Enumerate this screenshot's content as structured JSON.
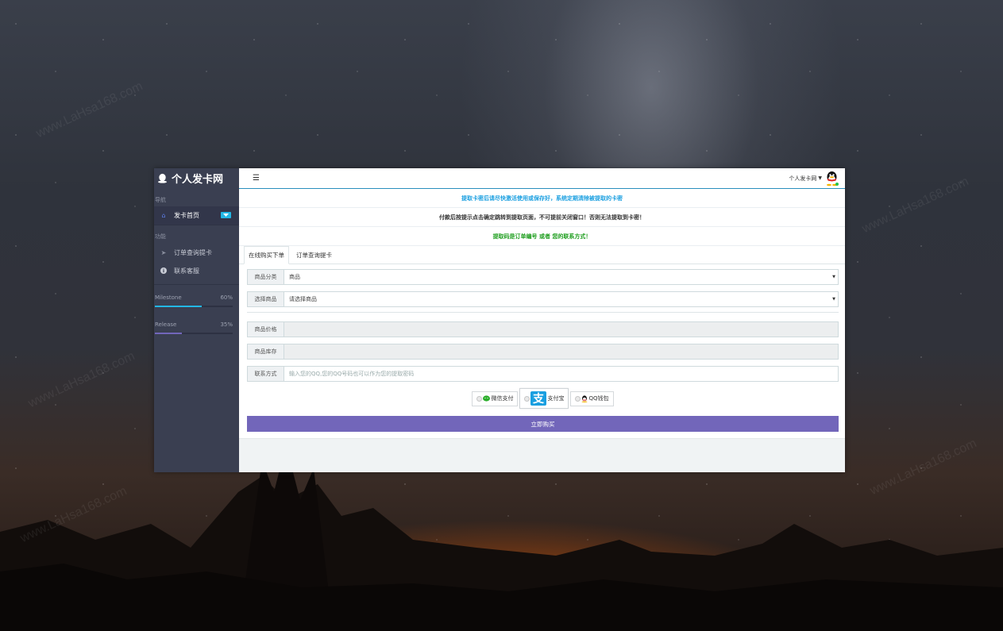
{
  "brand": {
    "title": "个人发卡网"
  },
  "sidebar": {
    "nav_header": "导航",
    "home_label": "发卡首页",
    "func_header": "功能",
    "items": [
      {
        "label": "订单查询提卡"
      },
      {
        "label": "联系客服"
      }
    ],
    "progress": [
      {
        "label": "Milestone",
        "value_text": "60%",
        "value": 0.6,
        "color": "#23b7e5"
      },
      {
        "label": "Release",
        "value_text": "35%",
        "value": 0.35,
        "color": "#7266ba"
      }
    ]
  },
  "topbar": {
    "user_label": "个人发卡网"
  },
  "notices": [
    {
      "text": "提取卡密后请尽快激活使用或保存好，系统定期清除被提取的卡密",
      "color": "#1a9fe0"
    },
    {
      "text": "付款后按提示点击确定跳转到提取页面，不可提前关闭窗口！否则无法提取到卡密！",
      "color": "#333333"
    },
    {
      "text": "提取码是订单编号 或者 您的联系方式！",
      "color": "#1e9e1e"
    }
  ],
  "tabs": [
    {
      "label": "在线购买下单"
    },
    {
      "label": "订单查询提卡"
    }
  ],
  "form": {
    "category_label": "商品分类",
    "category_value": "商品",
    "product_label": "选择商品",
    "product_value": "请选择商品",
    "price_label": "商品价格",
    "stock_label": "商品库存",
    "contact_label": "联系方式",
    "contact_placeholder": "输入您的QQ,您的QQ号码也可以作为您的提取密码"
  },
  "payment": {
    "wechat": "微信支付",
    "alipay": "支付宝",
    "qq": "QQ钱包"
  },
  "buy_button": "立即购买",
  "watermark": "www.LaHsa168.com"
}
